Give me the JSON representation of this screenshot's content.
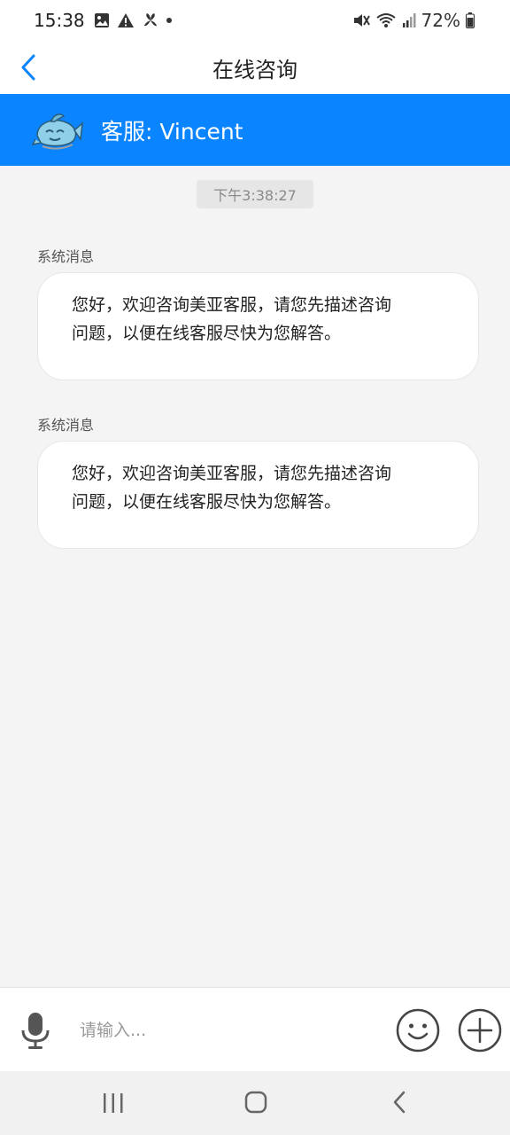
{
  "status": {
    "time": "15:38",
    "battery": "72%",
    "icons": [
      "gallery-icon",
      "warning-icon",
      "fan-icon",
      "dot-icon",
      "mute-icon",
      "wifi-icon",
      "signal-icon",
      "battery-icon"
    ]
  },
  "header": {
    "title": "在线咨询",
    "back_icon": "chevron-left-icon"
  },
  "agent": {
    "name": "客服: Vincent",
    "avatar_icon": "fish-avatar-icon"
  },
  "chat": {
    "timestamp": "下午3:38:27",
    "messages": [
      {
        "sender": "系统消息",
        "line1": "您好，欢迎咨询美亚客服，请您先描述咨询",
        "line2": "问题，以便在线客服尽快为您解答。"
      },
      {
        "sender": "系统消息",
        "line1": "您好，欢迎咨询美亚客服，请您先描述咨询",
        "line2": "问题，以便在线客服尽快为您解答。"
      }
    ]
  },
  "input": {
    "placeholder": "请输入...",
    "value": "",
    "icons": [
      "microphone-icon",
      "emoji-icon",
      "plus-icon"
    ]
  },
  "navigation": {
    "icons": [
      "recent-apps-icon",
      "home-icon",
      "back-icon"
    ]
  },
  "colors": {
    "accent": "#0a84ff",
    "background": "#f4f4f4",
    "bubble": "#ffffff"
  }
}
